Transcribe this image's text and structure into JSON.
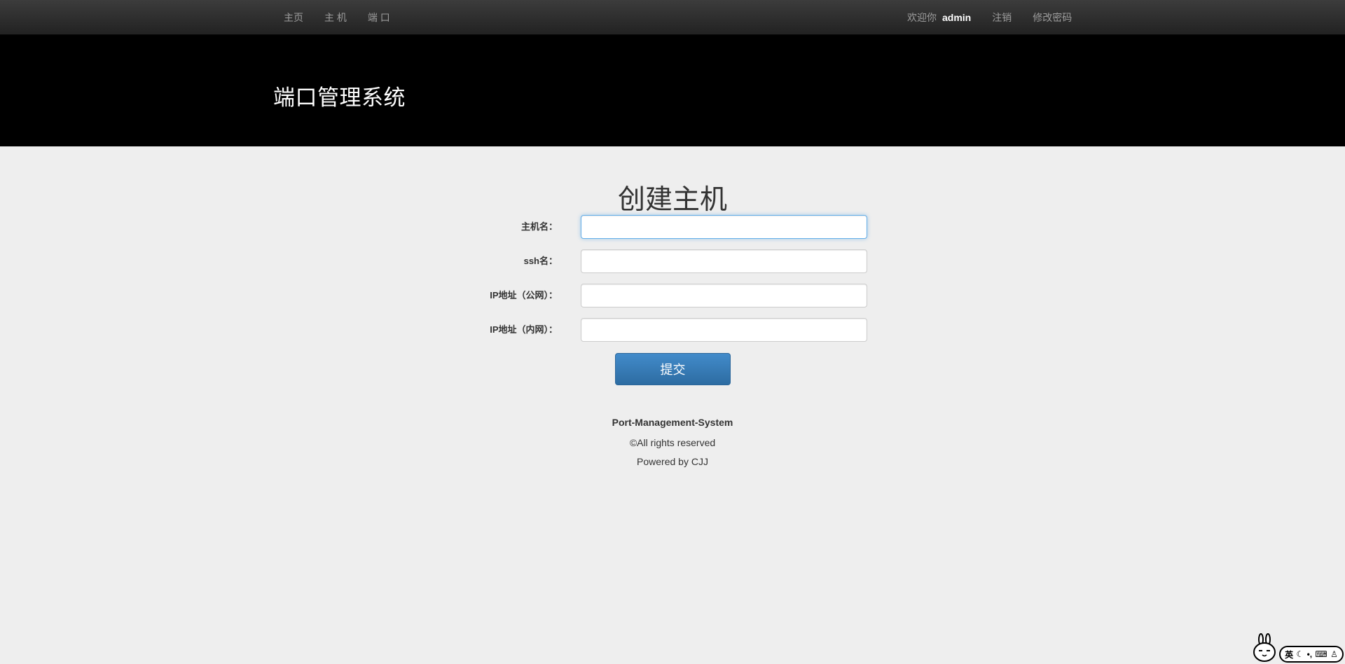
{
  "navbar": {
    "left_links": [
      "主页",
      "主 机",
      "端 口"
    ],
    "welcome_text": "欢迎你",
    "username": "admin",
    "logout_label": "注销",
    "change_password_label": "修改密码"
  },
  "header": {
    "site_title": "端口管理系统"
  },
  "form": {
    "title": "创建主机",
    "fields": [
      {
        "label": "主机名：",
        "value": "",
        "placeholder": ""
      },
      {
        "label": "ssh名：",
        "value": "",
        "placeholder": ""
      },
      {
        "label": "IP地址（公网）：",
        "value": "",
        "placeholder": ""
      },
      {
        "label": "IP地址（内网）：",
        "value": "",
        "placeholder": ""
      }
    ],
    "submit_label": "提交"
  },
  "footer": {
    "system_name": "Port-Management-System",
    "copyright": "©All rights reserved",
    "powered_by": "Powered by CJJ"
  },
  "ime": {
    "mode": "英",
    "icons": [
      "moon-icon",
      "punctuation-icon",
      "keyboard-icon",
      "clothes-icon"
    ]
  },
  "colors": {
    "navbar_bg": "#222222",
    "jumbotron_bg": "#000000",
    "page_bg": "#eeeeee",
    "primary_button": "#337ab7",
    "focus_border": "#66afe9"
  }
}
